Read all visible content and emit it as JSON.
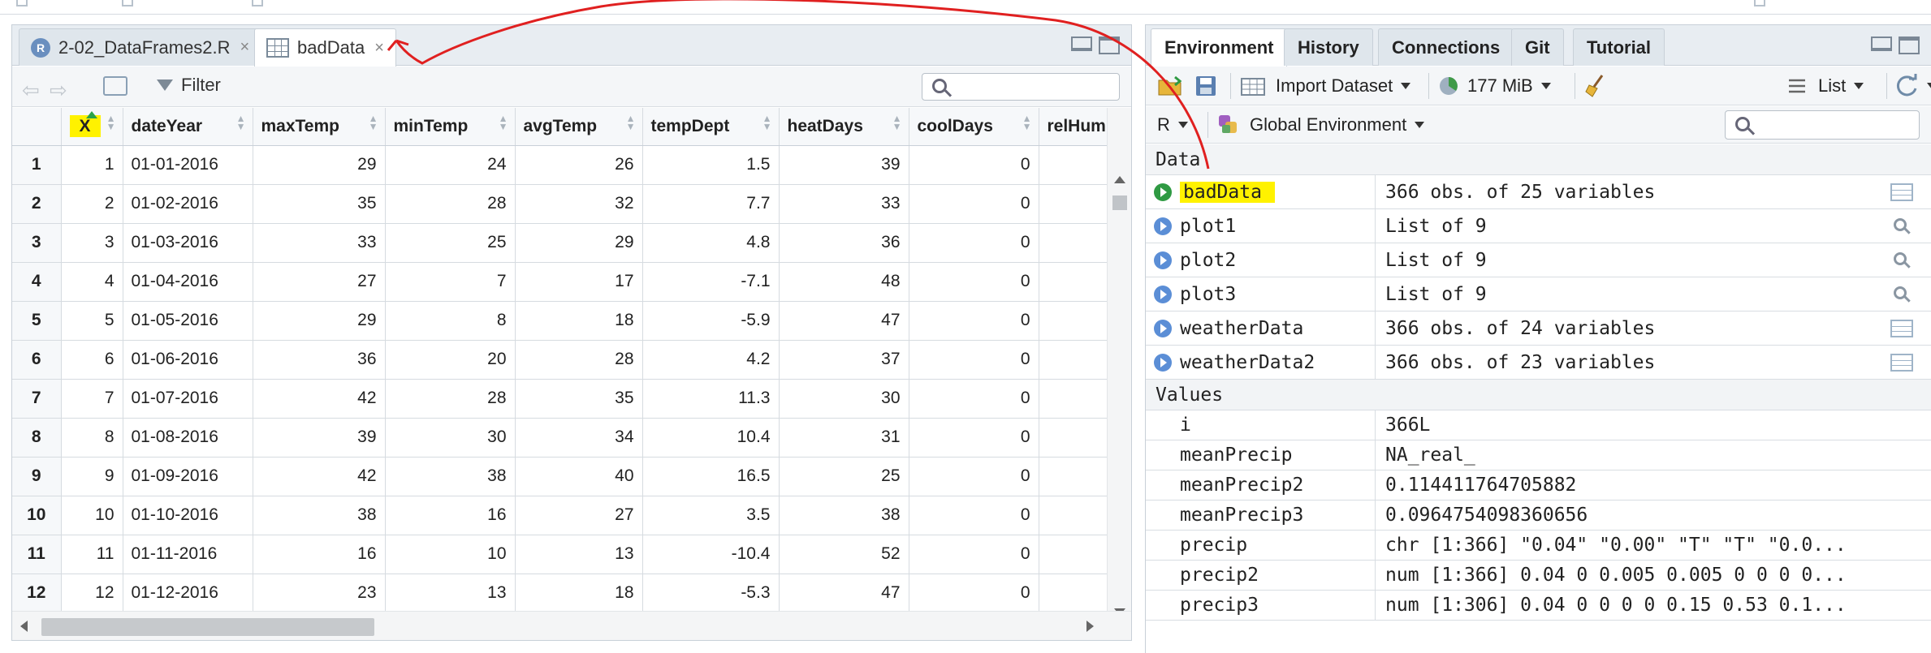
{
  "source_pane": {
    "tabs": [
      {
        "label": "2-02_DataFrames2.R",
        "close": "×"
      },
      {
        "label": "badData",
        "close": "×"
      }
    ],
    "toolbar": {
      "filter_label": "Filter",
      "back": "⇦",
      "forward": "⇨"
    },
    "columns": [
      "",
      "X",
      "dateYear",
      "maxTemp",
      "minTemp",
      "avgTemp",
      "tempDept",
      "heatDays",
      "coolDays",
      "relHum"
    ],
    "rows": [
      [
        "1",
        "1",
        "01-01-2016",
        "29",
        "24",
        "26",
        "1.5",
        "39",
        "0",
        ""
      ],
      [
        "2",
        "2",
        "01-02-2016",
        "35",
        "28",
        "32",
        "7.7",
        "33",
        "0",
        ""
      ],
      [
        "3",
        "3",
        "01-03-2016",
        "33",
        "25",
        "29",
        "4.8",
        "36",
        "0",
        ""
      ],
      [
        "4",
        "4",
        "01-04-2016",
        "27",
        "7",
        "17",
        "-7.1",
        "48",
        "0",
        ""
      ],
      [
        "5",
        "5",
        "01-05-2016",
        "29",
        "8",
        "18",
        "-5.9",
        "47",
        "0",
        ""
      ],
      [
        "6",
        "6",
        "01-06-2016",
        "36",
        "20",
        "28",
        "4.2",
        "37",
        "0",
        ""
      ],
      [
        "7",
        "7",
        "01-07-2016",
        "42",
        "28",
        "35",
        "11.3",
        "30",
        "0",
        ""
      ],
      [
        "8",
        "8",
        "01-08-2016",
        "39",
        "30",
        "34",
        "10.4",
        "31",
        "0",
        ""
      ],
      [
        "9",
        "9",
        "01-09-2016",
        "42",
        "38",
        "40",
        "16.5",
        "25",
        "0",
        ""
      ],
      [
        "10",
        "10",
        "01-10-2016",
        "38",
        "16",
        "27",
        "3.5",
        "38",
        "0",
        ""
      ],
      [
        "11",
        "11",
        "01-11-2016",
        "16",
        "10",
        "13",
        "-10.4",
        "52",
        "0",
        ""
      ],
      [
        "12",
        "12",
        "01-12-2016",
        "23",
        "13",
        "18",
        "-5.3",
        "47",
        "0",
        ""
      ]
    ]
  },
  "env_pane": {
    "tabs": [
      "Environment",
      "History",
      "Connections",
      "Git",
      "Tutorial"
    ],
    "toolbar": {
      "import_label": "Import Dataset",
      "memory_label": "177 MiB",
      "view_label": "List"
    },
    "scope": {
      "language": "R",
      "env_label": "Global Environment"
    },
    "sections": {
      "data": "Data",
      "values": "Values"
    },
    "data_items": [
      {
        "name": "badData",
        "value": "366 obs. of 25 variables",
        "icon": "table-icon"
      },
      {
        "name": "plot1",
        "value": "List of  9",
        "icon": "magnifier-icon"
      },
      {
        "name": "plot2",
        "value": "List of  9",
        "icon": "magnifier-icon"
      },
      {
        "name": "plot3",
        "value": "List of  9",
        "icon": "magnifier-icon"
      },
      {
        "name": "weatherData",
        "value": "366 obs. of 24 variables",
        "icon": "table-icon"
      },
      {
        "name": "weatherData2",
        "value": "366 obs. of 23 variables",
        "icon": "table-icon"
      }
    ],
    "value_items": [
      {
        "name": "i",
        "value": "366L"
      },
      {
        "name": "meanPrecip",
        "value": "NA_real_"
      },
      {
        "name": "meanPrecip2",
        "value": "0.114411764705882"
      },
      {
        "name": "meanPrecip3",
        "value": "0.0964754098360656"
      },
      {
        "name": "precip",
        "value": "chr [1:366] \"0.04\" \"0.00\" \"T\" \"T\" \"0.0..."
      },
      {
        "name": "precip2",
        "value": "num [1:366] 0.04 0 0.005 0.005 0 0 0 0..."
      },
      {
        "name": "precip3",
        "value": "num [1:306] 0.04 0 0 0 0 0.15 0.53 0.1..."
      }
    ]
  },
  "colors": {
    "highlight": "#fff200",
    "annotation": "#e02020",
    "data_icon": "#5b8ed6",
    "active_data_icon": "#2f9a43"
  }
}
